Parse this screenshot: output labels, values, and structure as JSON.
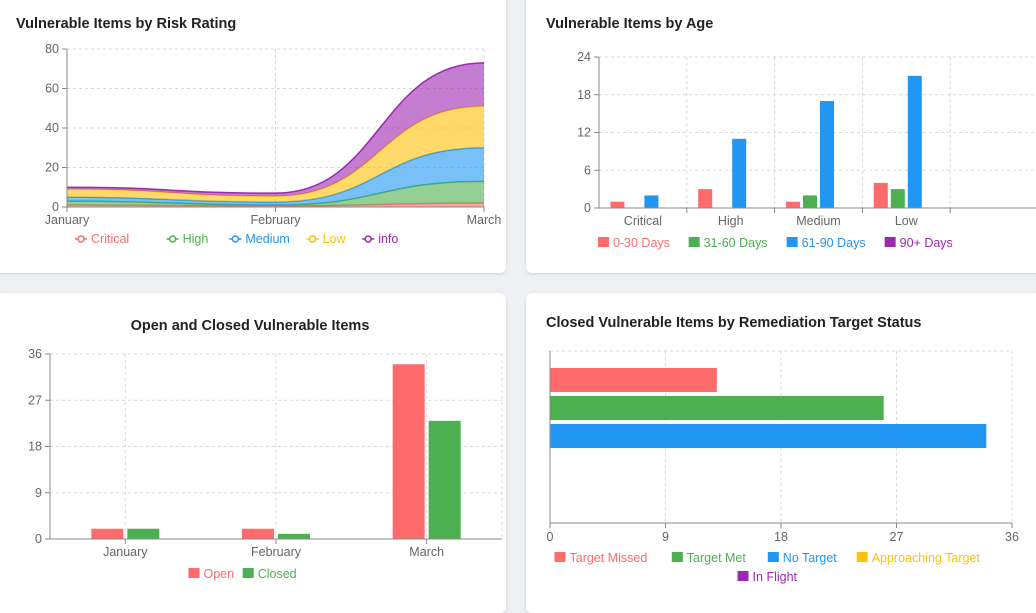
{
  "colors": {
    "red": "#ff6b6b",
    "green": "#4caf50",
    "blue": "#2196f3",
    "yellow": "#ffc107",
    "purple": "#9c27b0"
  },
  "chart_data": [
    {
      "id": "risk",
      "type": "area",
      "title": "Vulnerable Items by Risk Rating",
      "stacked": true,
      "x": [
        "January",
        "February",
        "March"
      ],
      "ylim": [
        0,
        80
      ],
      "yticks": [
        0,
        20,
        40,
        60,
        80
      ],
      "grid": true,
      "legend": "bottom",
      "series": [
        {
          "name": "Critical",
          "values": [
            1,
            0.5,
            2
          ],
          "color": "#ff6b6b"
        },
        {
          "name": "High",
          "values": [
            2,
            0.5,
            11
          ],
          "color": "#4caf50"
        },
        {
          "name": "Medium",
          "values": [
            2,
            1.5,
            17
          ],
          "color": "#2196f3"
        },
        {
          "name": "Low",
          "values": [
            4,
            3,
            21
          ],
          "color": "#ffc107"
        },
        {
          "name": "info",
          "values": [
            1,
            1.5,
            22
          ],
          "color": "#9c27b0"
        }
      ]
    },
    {
      "id": "age",
      "type": "bar",
      "title": "Vulnerable Items by Age",
      "categories": [
        "Critical",
        "High",
        "Medium",
        "Low"
      ],
      "ylim": [
        0,
        24
      ],
      "yticks": [
        0,
        6,
        12,
        18,
        24
      ],
      "grid": true,
      "legend": "bottom",
      "series": [
        {
          "name": "0-30 Days",
          "values": [
            1,
            3,
            1,
            4
          ],
          "color": "#ff6b6b"
        },
        {
          "name": "31-60 Days",
          "values": [
            0,
            0,
            2,
            3
          ],
          "color": "#4caf50"
        },
        {
          "name": "61-90 Days",
          "values": [
            2,
            11,
            17,
            21
          ],
          "color": "#2196f3"
        },
        {
          "name": "90+ Days",
          "values": [
            0,
            0,
            0,
            0
          ],
          "color": "#9c27b0"
        }
      ]
    },
    {
      "id": "openclosed",
      "type": "bar",
      "title": "Open and Closed Vulnerable Items",
      "categories": [
        "January",
        "February",
        "March"
      ],
      "ylim": [
        0,
        36
      ],
      "yticks": [
        0,
        9,
        18,
        27,
        36
      ],
      "grid": true,
      "legend": "bottom",
      "series": [
        {
          "name": "Open",
          "values": [
            2,
            2,
            34
          ],
          "color": "#ff6b6b"
        },
        {
          "name": "Closed",
          "values": [
            2,
            1,
            23
          ],
          "color": "#4caf50"
        }
      ]
    },
    {
      "id": "target",
      "type": "bar",
      "orientation": "horizontal",
      "title": "Closed Vulnerable Items by Remediation Target Status",
      "xlim": [
        0,
        36
      ],
      "xticks": [
        0,
        9,
        18,
        27,
        36
      ],
      "grid": true,
      "legend": "bottom",
      "series": [
        {
          "name": "Target Missed",
          "value": 13,
          "color": "#ff6b6b"
        },
        {
          "name": "Target Met",
          "value": 26,
          "color": "#4caf50"
        },
        {
          "name": "No Target",
          "value": 34,
          "color": "#2196f3"
        },
        {
          "name": "Approaching Target",
          "value": 0,
          "color": "#ffc107"
        },
        {
          "name": "In Flight",
          "value": 0,
          "color": "#9c27b0"
        }
      ]
    }
  ]
}
